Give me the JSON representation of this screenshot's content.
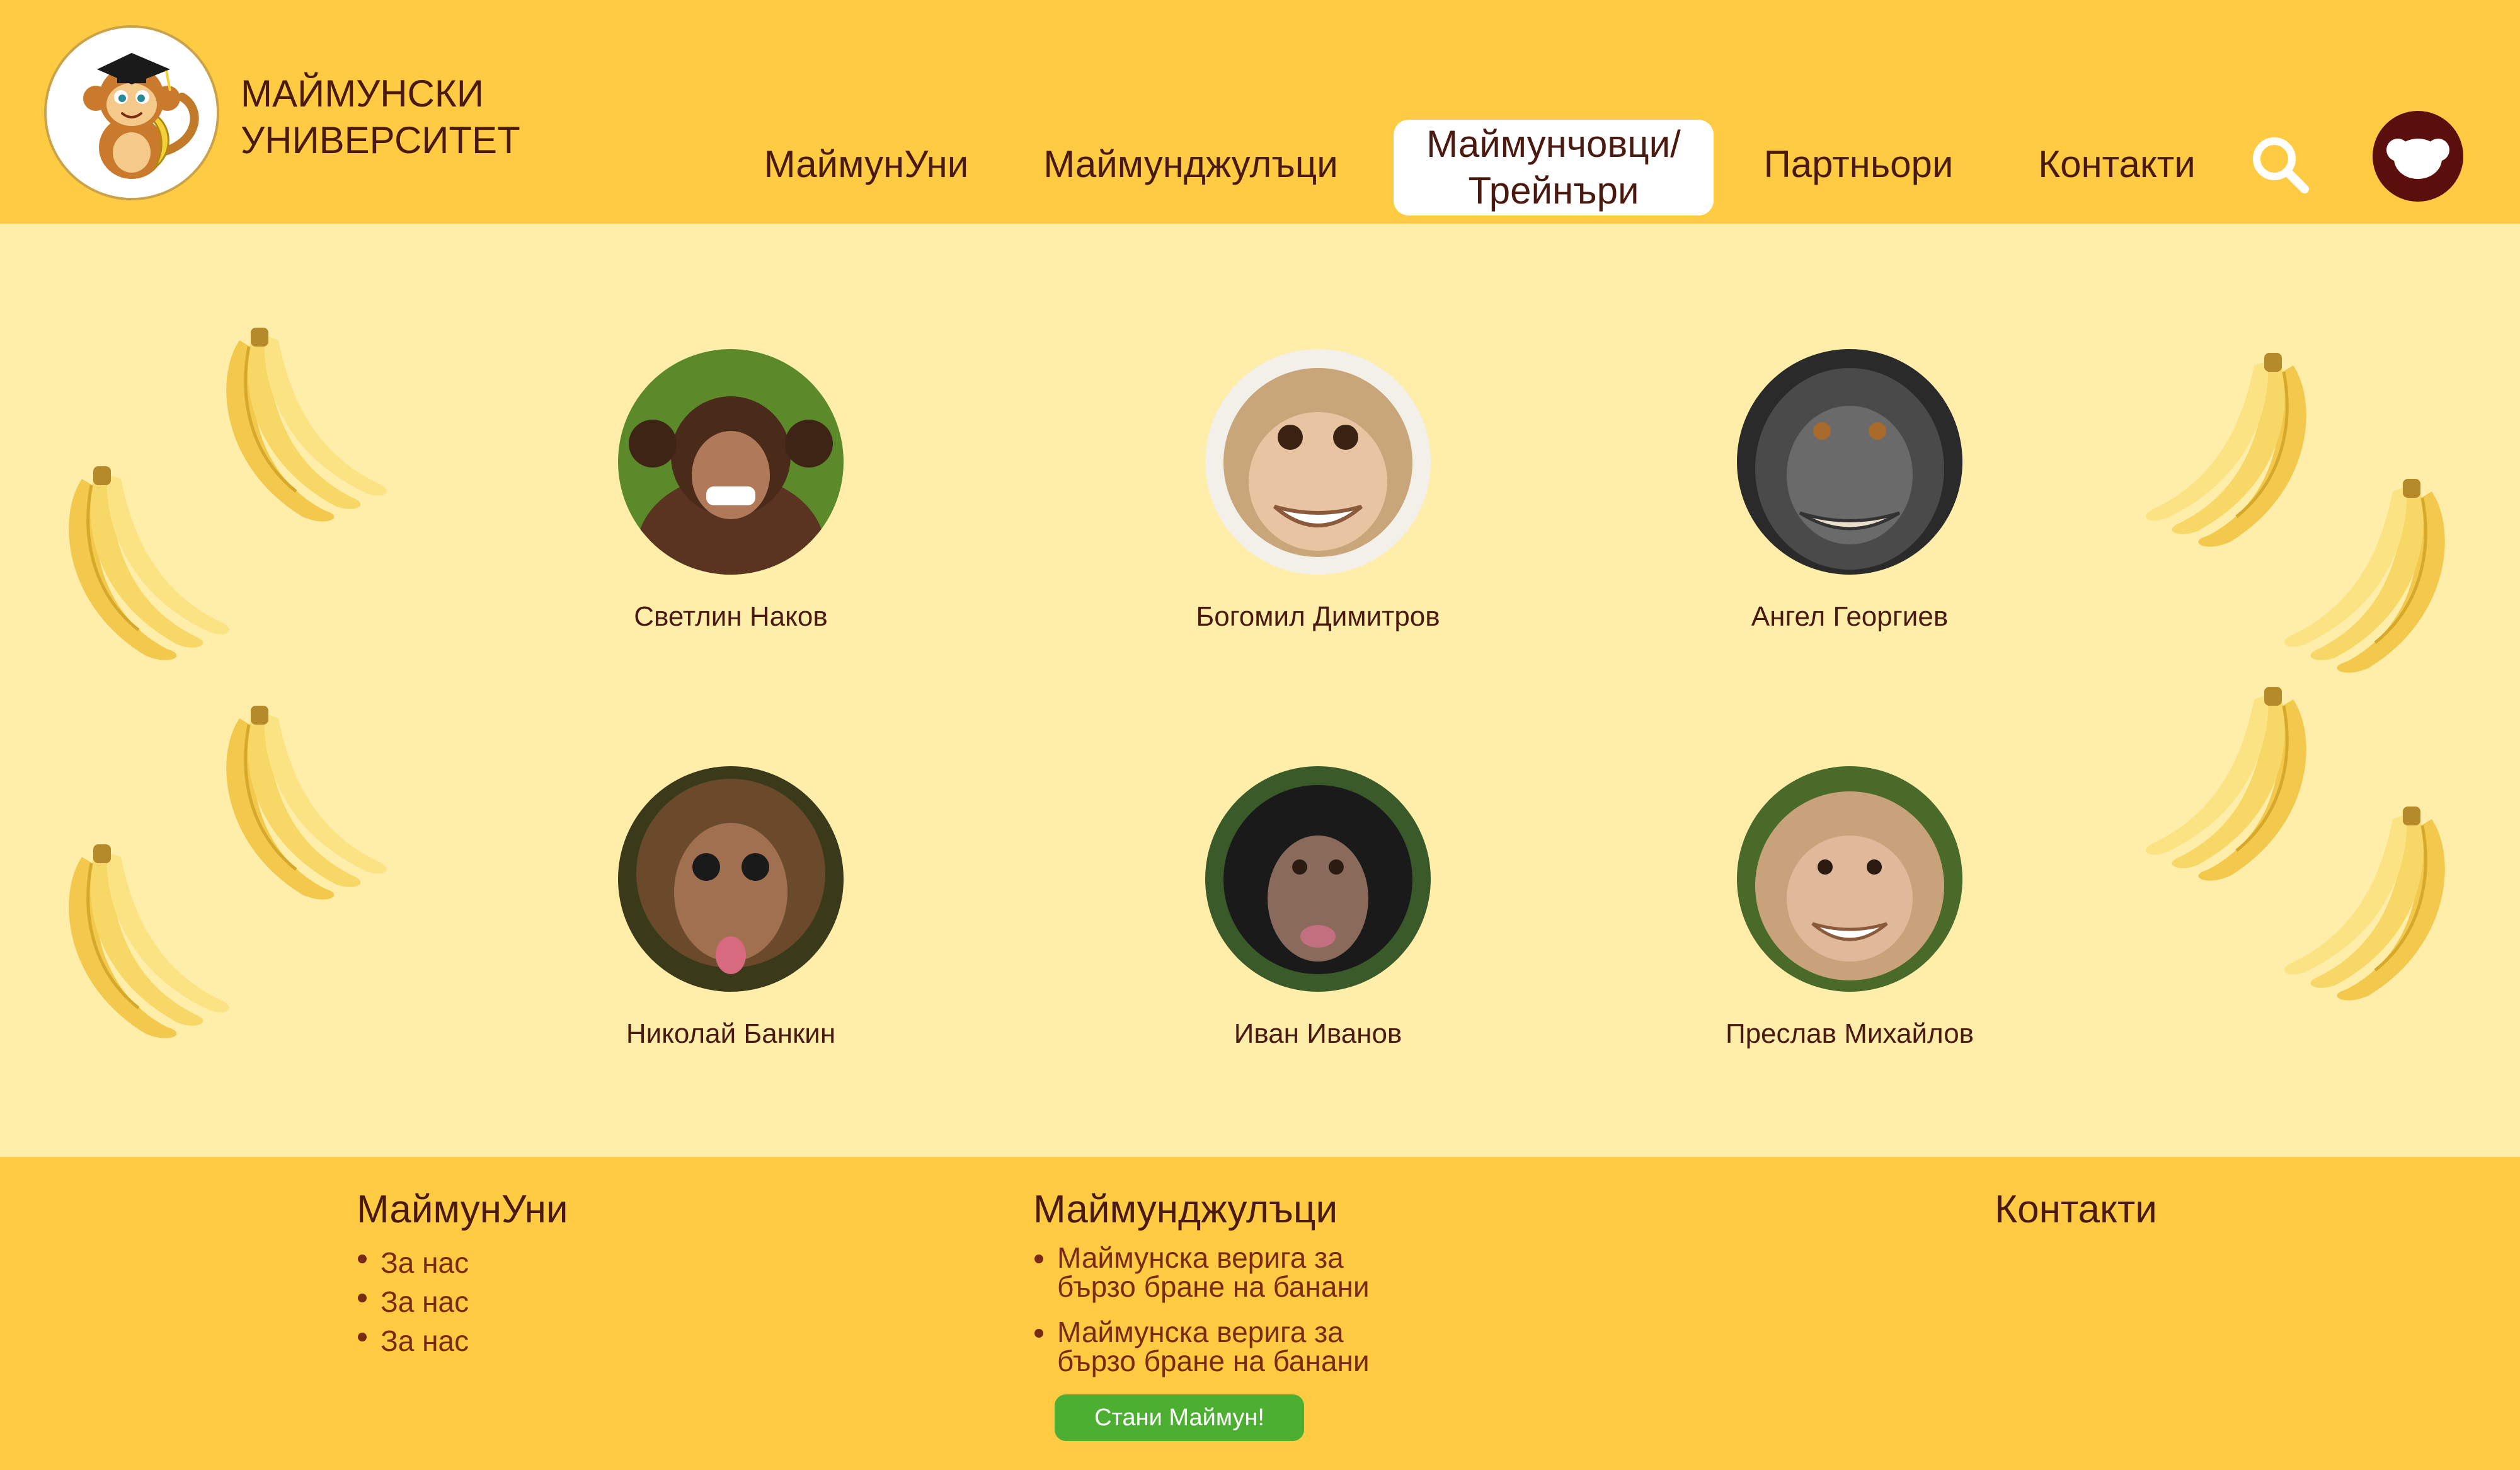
{
  "header": {
    "logo_line1": "МАЙМУНСКИ",
    "logo_line2": "УНИВЕРСИТЕТ",
    "nav": [
      {
        "label": "МаймунУни"
      },
      {
        "label": "Маймунджулъци"
      },
      {
        "label_line1": "Маймунчовци/",
        "label_line2": "Трейнъри",
        "active": true
      },
      {
        "label": "Партньори"
      },
      {
        "label": "Контакти"
      }
    ]
  },
  "trainers": [
    {
      "name": "Светлин Наков"
    },
    {
      "name": "Богомил Димитров"
    },
    {
      "name": "Ангел Георгиев"
    },
    {
      "name": "Николай Банкин"
    },
    {
      "name": "Иван Иванов"
    },
    {
      "name": "Преслав Михайлов"
    }
  ],
  "footer": {
    "col1": {
      "title": "МаймунУни",
      "items": [
        "За нас",
        "За нас",
        "За нас"
      ]
    },
    "col2": {
      "title": "Маймунджулъци",
      "items": [
        {
          "line1": "Маймунска верига за",
          "line2": "бързо бране на банани"
        },
        {
          "line1": "Маймунска верига за",
          "line2": "бързо бране на банани"
        }
      ]
    },
    "col3": {
      "title": "Контакти"
    },
    "cta": "Стани Маймун!"
  },
  "colors": {
    "header_bg": "#fecb42",
    "main_bg": "#ffedaa",
    "text_brown": "#4a1a10",
    "cta_green": "#4caf32",
    "avatar_bg": "#5a0f0c"
  },
  "icons": [
    "monkey-logo-icon",
    "search-icon",
    "monkey-avatar-icon",
    "banana-icon"
  ]
}
